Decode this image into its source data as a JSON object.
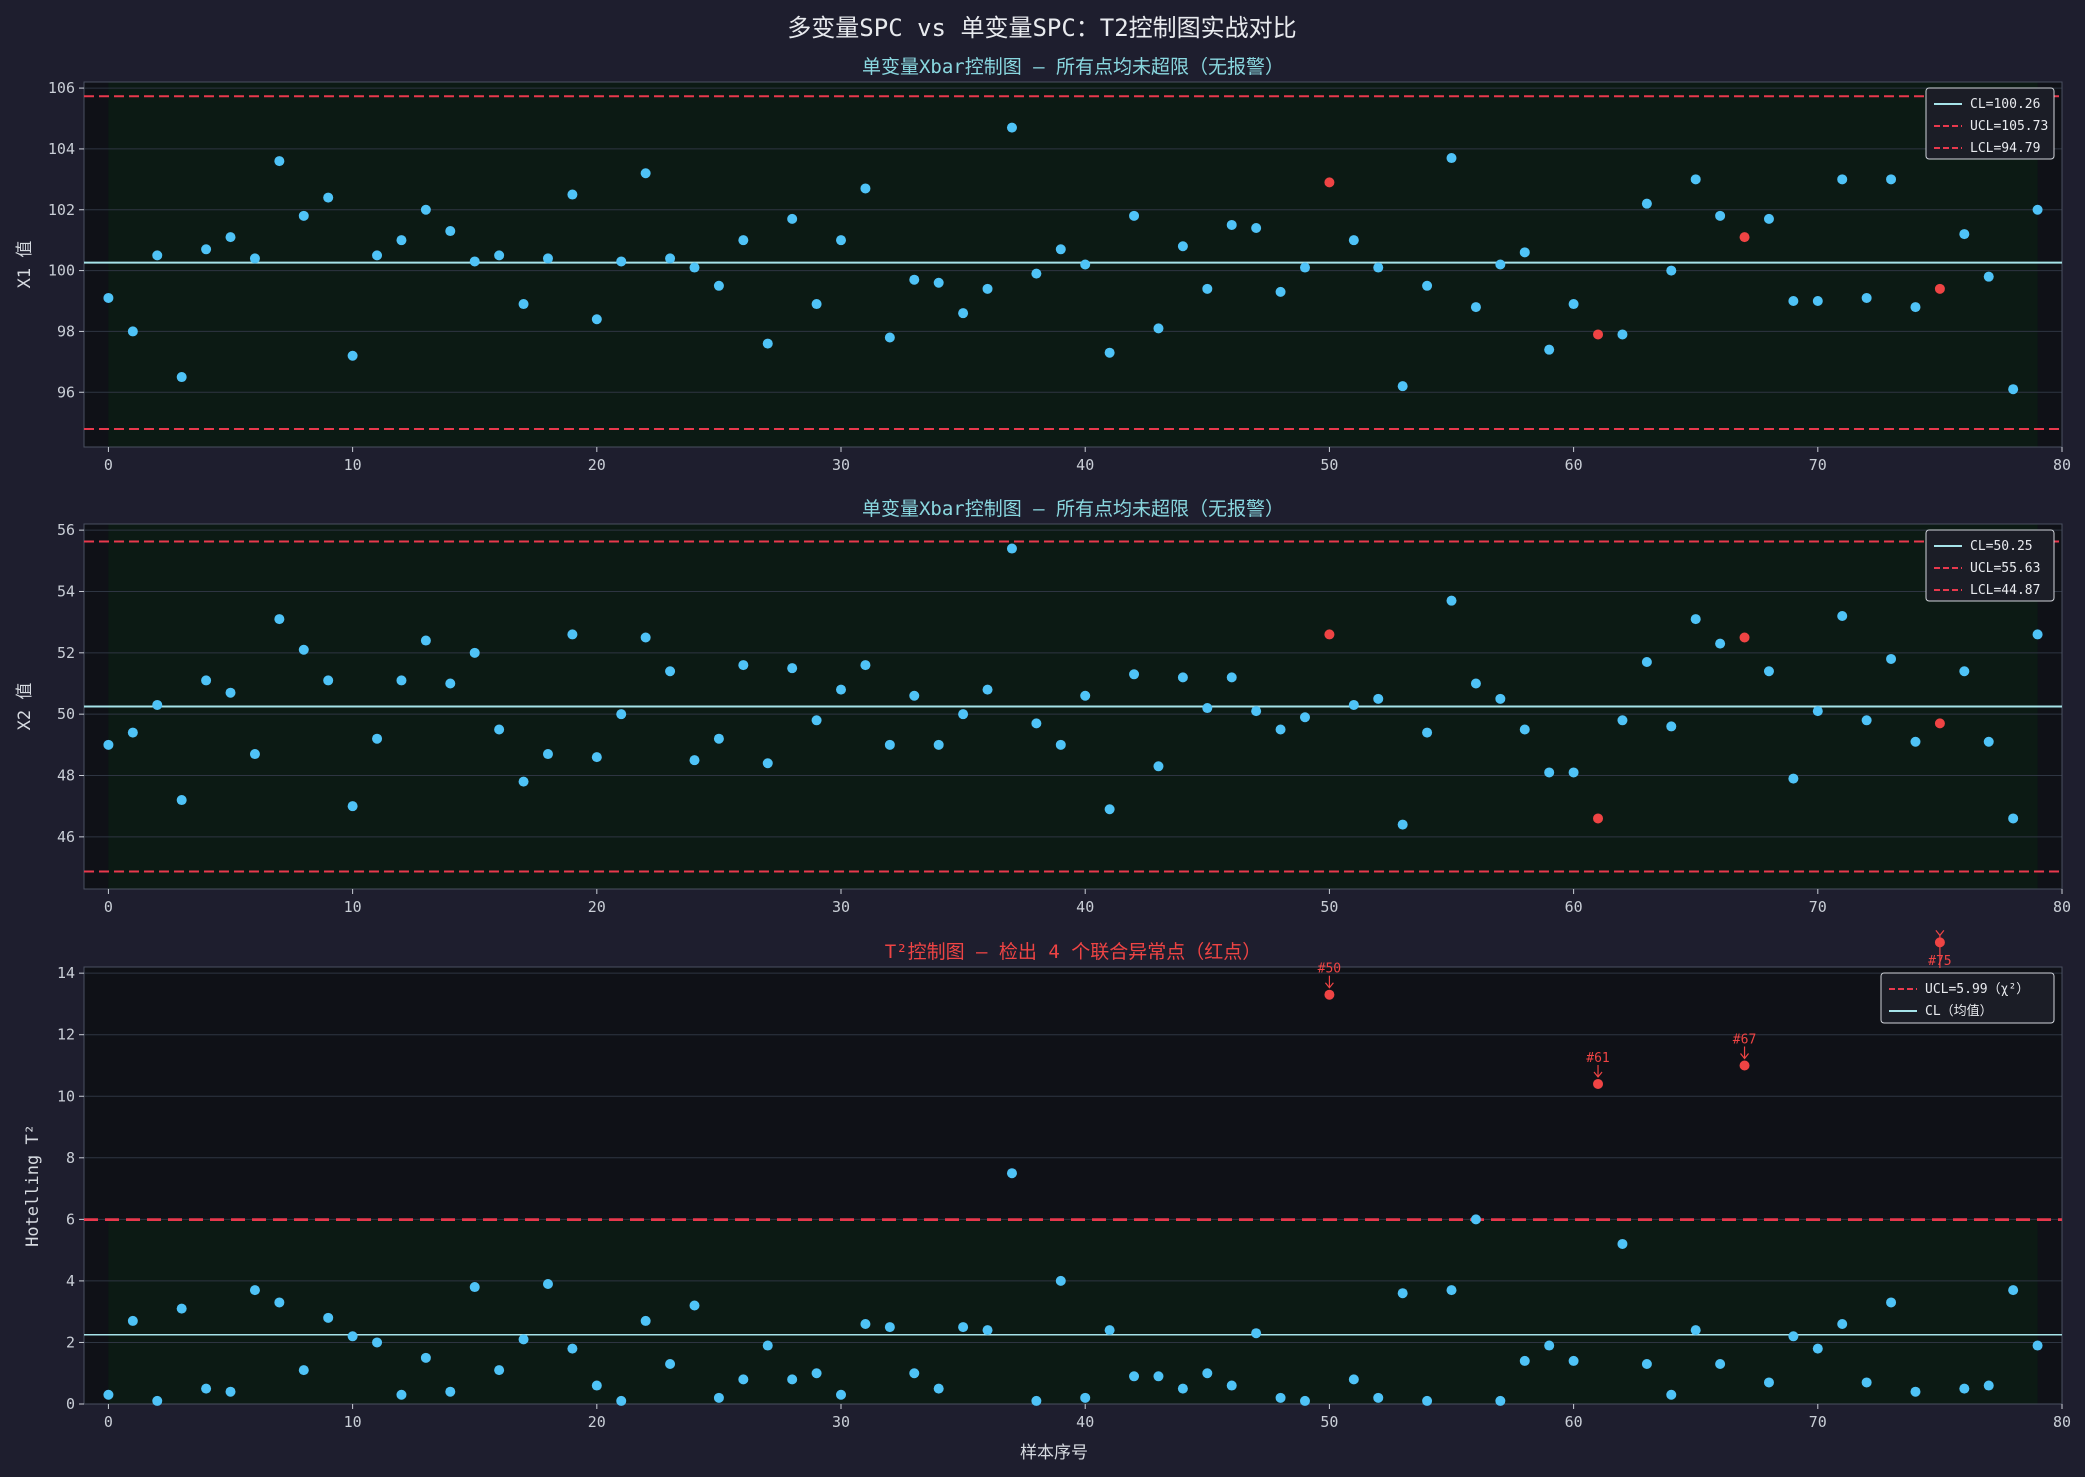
{
  "figure": {
    "title": "多变量SPC vs 单变量SPC：T2控制图实战对比",
    "xlabel": "样本序号",
    "colors": {
      "background": "#1e1e2e",
      "plot_bg": "#0f1117",
      "zone": "#0c1a14",
      "normal_point": "#4fc3f7",
      "alarm_point": "#ef4444",
      "cl_line": "#a6e3e9",
      "limit_line": "#e8394d",
      "title_upper": "#8ad8e0",
      "title_alarm": "#ef4444",
      "text": "#e8eaee"
    }
  },
  "chart_data": [
    {
      "type": "scatter",
      "title": "单变量Xbar控制图 — 所有点均未超限（无报警）",
      "ylabel": "X1 值",
      "xlim": [
        -1,
        80
      ],
      "ylim": [
        94.2,
        106.2
      ],
      "xticks": [
        0,
        10,
        20,
        30,
        40,
        50,
        60,
        70,
        80
      ],
      "yticks": [
        96,
        98,
        100,
        102,
        104,
        106
      ],
      "cl": 100.26,
      "ucl": 105.73,
      "lcl": 94.79,
      "legend": [
        "CL=100.26",
        "UCL=105.73",
        "LCL=94.79"
      ],
      "legend_position": "upper right",
      "alarm_indices": [
        50,
        61,
        67,
        75
      ],
      "y": [
        99.1,
        98.0,
        100.5,
        96.5,
        100.7,
        101.1,
        100.4,
        103.6,
        101.8,
        102.4,
        97.2,
        100.5,
        101.0,
        102.0,
        101.3,
        100.3,
        100.5,
        98.9,
        100.4,
        102.5,
        98.4,
        100.3,
        103.2,
        100.4,
        100.1,
        99.5,
        101.0,
        97.6,
        101.7,
        98.9,
        101.0,
        102.7,
        97.8,
        99.7,
        99.6,
        98.6,
        99.4,
        104.7,
        99.9,
        100.7,
        100.2,
        97.3,
        101.8,
        98.1,
        100.8,
        99.4,
        101.5,
        101.4,
        99.3,
        100.1,
        102.9,
        101.0,
        100.1,
        96.2,
        99.5,
        103.7,
        98.8,
        100.2,
        100.6,
        97.4,
        98.9,
        97.9,
        97.9,
        102.2,
        100.0,
        103.0,
        101.8,
        101.1,
        101.7,
        99.0,
        99.0,
        103.0,
        99.1,
        103.0,
        98.8,
        99.4,
        101.2,
        99.8,
        96.1,
        102.0
      ]
    },
    {
      "type": "scatter",
      "title": "单变量Xbar控制图 — 所有点均未超限（无报警）",
      "ylabel": "X2 值",
      "xlim": [
        -1,
        80
      ],
      "ylim": [
        44.3,
        56.2
      ],
      "xticks": [
        0,
        10,
        20,
        30,
        40,
        50,
        60,
        70,
        80
      ],
      "yticks": [
        46,
        48,
        50,
        52,
        54,
        56
      ],
      "cl": 50.25,
      "ucl": 55.63,
      "lcl": 44.87,
      "legend": [
        "CL=50.25",
        "UCL=55.63",
        "LCL=44.87"
      ],
      "legend_position": "upper right",
      "alarm_indices": [
        50,
        61,
        67,
        75
      ],
      "y": [
        49.0,
        49.4,
        50.3,
        47.2,
        51.1,
        50.7,
        48.7,
        53.1,
        52.1,
        51.1,
        47.0,
        49.2,
        51.1,
        52.4,
        51.0,
        52.0,
        49.5,
        47.8,
        48.7,
        52.6,
        48.6,
        50.0,
        52.5,
        51.4,
        48.5,
        49.2,
        51.6,
        48.4,
        51.5,
        49.8,
        50.8,
        51.6,
        49.0,
        50.6,
        49.0,
        50.0,
        50.8,
        55.4,
        49.7,
        49.0,
        50.6,
        46.9,
        51.3,
        48.3,
        51.2,
        50.2,
        51.2,
        50.1,
        49.5,
        49.9,
        52.6,
        50.3,
        50.5,
        46.4,
        49.4,
        53.7,
        51.0,
        50.5,
        49.5,
        48.1,
        48.1,
        46.6,
        49.8,
        51.7,
        49.6,
        53.1,
        52.3,
        52.5,
        51.4,
        47.9,
        50.1,
        53.2,
        49.8,
        51.8,
        49.1,
        49.7,
        51.4,
        49.1,
        46.6,
        52.6
      ]
    },
    {
      "type": "scatter",
      "title": "T²控制图 — 检出 4 个联合异常点（红点）",
      "ylabel": "Hotelling T²",
      "xlim": [
        -1,
        80
      ],
      "ylim": [
        0,
        14.2
      ],
      "xticks": [
        0,
        10,
        20,
        30,
        40,
        50,
        60,
        70,
        80
      ],
      "yticks": [
        0,
        2,
        4,
        6,
        8,
        10,
        12,
        14
      ],
      "cl": 2.25,
      "ucl": 5.99,
      "legend": [
        "UCL=5.99（χ²）",
        "CL（均值）"
      ],
      "legend_position": "upper right",
      "alarm_indices": [
        50,
        61,
        67,
        75
      ],
      "annotations": [
        {
          "x": 50,
          "label": "#50"
        },
        {
          "x": 61,
          "label": "#61"
        },
        {
          "x": 67,
          "label": "#67"
        },
        {
          "x": 75,
          "label": "#75"
        }
      ],
      "y": [
        0.3,
        2.7,
        0.1,
        3.1,
        0.5,
        0.4,
        3.7,
        3.3,
        1.1,
        2.8,
        2.2,
        2.0,
        0.3,
        1.5,
        0.4,
        3.8,
        1.1,
        2.1,
        3.9,
        1.8,
        0.6,
        0.1,
        2.7,
        1.3,
        3.2,
        0.2,
        0.8,
        1.9,
        0.8,
        1.0,
        0.3,
        2.6,
        2.5,
        1.0,
        0.5,
        2.5,
        2.4,
        7.5,
        0.1,
        4.0,
        0.2,
        2.4,
        0.9,
        0.9,
        0.5,
        1.0,
        0.6,
        2.3,
        0.2,
        0.1,
        13.3,
        0.8,
        0.2,
        3.6,
        0.1,
        3.7,
        6.0,
        0.1,
        1.4,
        1.9,
        1.4,
        10.4,
        5.2,
        1.3,
        0.3,
        2.4,
        1.3,
        11.0,
        0.7,
        2.2,
        1.8,
        2.6,
        0.7,
        3.3,
        0.4,
        15.0,
        0.5,
        0.6,
        3.7,
        1.9
      ]
    }
  ]
}
